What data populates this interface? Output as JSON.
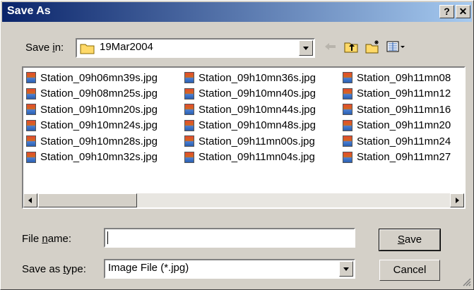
{
  "title": "Save As",
  "titlebar_buttons": {
    "help": "?",
    "close": "✕"
  },
  "save_in": {
    "label_prefix": "Save ",
    "label_mnemonic": "i",
    "label_suffix": "n:",
    "folder": "19Mar2004"
  },
  "files": [
    [
      "Station_09h06mn39s.jpg",
      "Station_09h08mn25s.jpg",
      "Station_09h10mn20s.jpg",
      "Station_09h10mn24s.jpg",
      "Station_09h10mn28s.jpg",
      "Station_09h10mn32s.jpg"
    ],
    [
      "Station_09h10mn36s.jpg",
      "Station_09h10mn40s.jpg",
      "Station_09h10mn44s.jpg",
      "Station_09h10mn48s.jpg",
      "Station_09h11mn00s.jpg",
      "Station_09h11mn04s.jpg"
    ],
    [
      "Station_09h11mn08",
      "Station_09h11mn12",
      "Station_09h11mn16",
      "Station_09h11mn20",
      "Station_09h11mn24",
      "Station_09h11mn27"
    ]
  ],
  "file_name": {
    "label_prefix": "File ",
    "label_mnemonic": "n",
    "label_suffix": "ame:",
    "value": ""
  },
  "save_as_type": {
    "label_prefix": "Save as ",
    "label_mnemonic": "t",
    "label_suffix": "ype:",
    "value": "Image File (*.jpg)"
  },
  "buttons": {
    "save_mnemonic": "S",
    "save_rest": "ave",
    "cancel": "Cancel"
  },
  "colors": {
    "title_start": "#0a246a",
    "title_end": "#a6caf0",
    "face": "#d4d0c8"
  }
}
